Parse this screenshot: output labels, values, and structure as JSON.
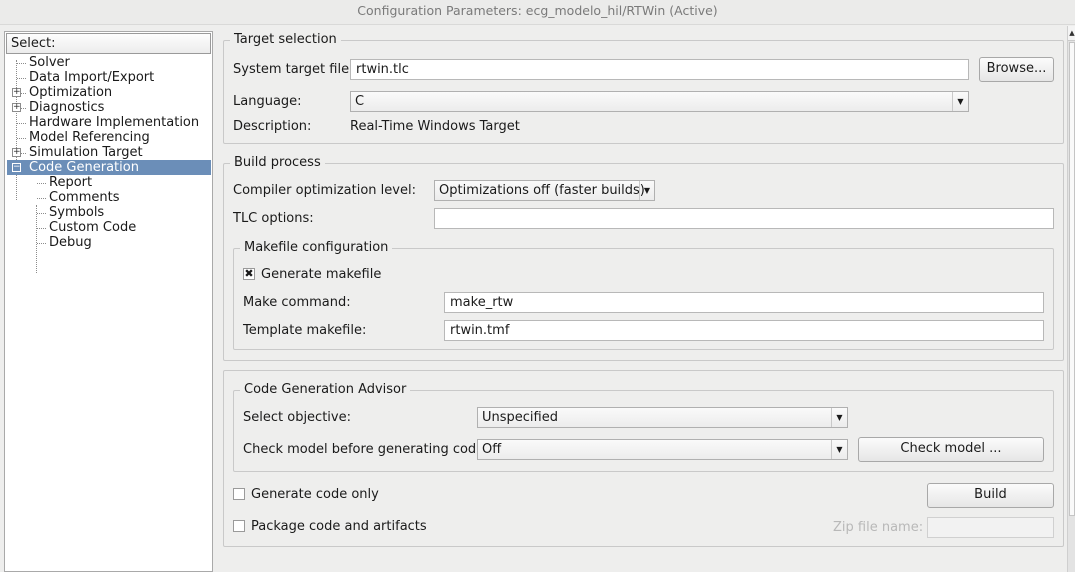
{
  "window": {
    "title": "Configuration Parameters: ecg_modelo_hil/RTWin (Active)"
  },
  "tree": {
    "header": "Select:",
    "items": [
      {
        "label": "Solver",
        "expander": ""
      },
      {
        "label": "Data Import/Export",
        "expander": ""
      },
      {
        "label": "Optimization",
        "expander": "+"
      },
      {
        "label": "Diagnostics",
        "expander": "+"
      },
      {
        "label": "Hardware Implementation",
        "expander": ""
      },
      {
        "label": "Model Referencing",
        "expander": ""
      },
      {
        "label": "Simulation Target",
        "expander": "+"
      },
      {
        "label": "Code Generation",
        "expander": "−",
        "selected": true
      },
      {
        "label": "Report"
      },
      {
        "label": "Comments"
      },
      {
        "label": "Symbols"
      },
      {
        "label": "Custom Code"
      },
      {
        "label": "Debug"
      }
    ]
  },
  "target_selection": {
    "title": "Target selection",
    "system_target_label": "System target file:",
    "system_target_value": "rtwin.tlc",
    "browse_label": "Browse...",
    "language_label": "Language:",
    "language_value": "C",
    "description_label": "Description:",
    "description_value": "Real-Time Windows Target"
  },
  "build_process": {
    "title": "Build process",
    "compiler_opt_label": "Compiler optimization level:",
    "compiler_opt_value": "Optimizations off (faster builds)",
    "tlc_options_label": "TLC options:",
    "tlc_options_value": "",
    "makefile": {
      "title": "Makefile configuration",
      "generate_label": "Generate makefile",
      "generate_checked": true,
      "make_command_label": "Make command:",
      "make_command_value": "make_rtw",
      "template_label": "Template makefile:",
      "template_value": "rtwin.tmf"
    }
  },
  "advisor": {
    "title": "Code Generation Advisor",
    "objective_label": "Select objective:",
    "objective_value": "Unspecified",
    "check_label": "Check model before generating code:",
    "check_value": "Off",
    "check_button": "Check model ..."
  },
  "bottom": {
    "generate_only_label": "Generate code only",
    "generate_only_checked": false,
    "build_button": "Build",
    "package_label": "Package code and artifacts",
    "package_checked": false,
    "zip_label": "Zip file name:",
    "zip_value": ""
  },
  "icons": {
    "combo_arrow": "▼",
    "check_mark": "✖",
    "scroll_up": "▲"
  },
  "colors": {
    "selection": "#6b8eb8",
    "panel_bg": "#eeeeed"
  }
}
